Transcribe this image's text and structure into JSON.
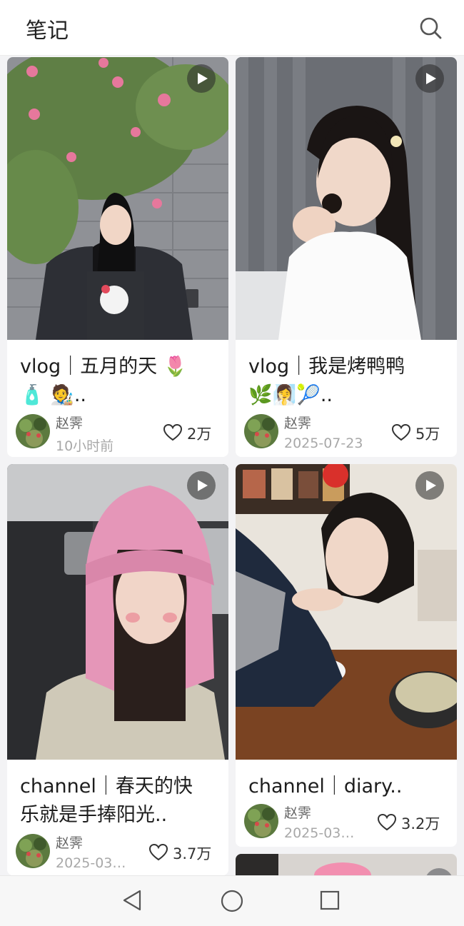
{
  "header": {
    "title": "笔记",
    "search_icon": "search-icon"
  },
  "cards": [
    {
      "title": "vlog｜五月的天 🌷",
      "title_line2": "🧴 🧑‍🎨..",
      "author": "赵霁",
      "time": "10小时前",
      "likes": "2万"
    },
    {
      "title": "vlog｜我是烤鸭鸭",
      "title_line2": "🌿🧖‍♀️🎾..",
      "author": "赵霁",
      "time": "2025-07-23",
      "likes": "5万"
    },
    {
      "title": "channel｜春天的快",
      "title_line2": "乐就是手捧阳光..",
      "author": "赵霁",
      "time": "2025-03…",
      "likes": "3.7万"
    },
    {
      "title": "channel｜diary..",
      "author": "赵霁",
      "time": "2025-03…",
      "likes": "3.2万"
    }
  ],
  "navbar": {
    "back": "back-icon",
    "home": "home-icon",
    "recents": "recents-icon"
  },
  "colors": {
    "accent_pink": "#e6789c",
    "text": "#1d1d1d",
    "muted": "#a8a8a8"
  }
}
